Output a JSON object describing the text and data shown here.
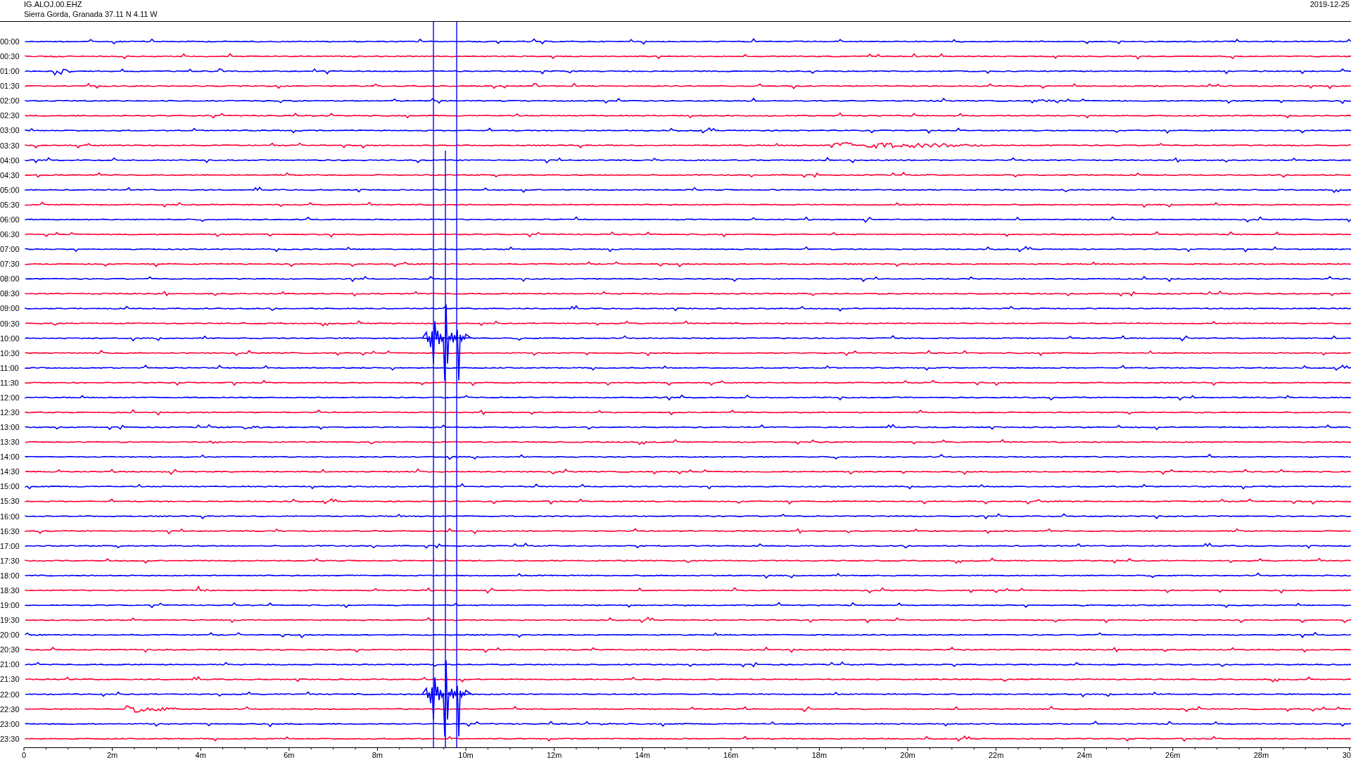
{
  "header": {
    "station": "IG.ALOJ.00.EHZ",
    "location": "Sierra Gorda, Granada  37.11 N 4.11 W",
    "date": "2019-12-25"
  },
  "rows": [
    {
      "label": "00:00",
      "color": "#0000ff"
    },
    {
      "label": "00:30",
      "color": "#ff0033"
    },
    {
      "label": "01:00",
      "color": "#0000ff"
    },
    {
      "label": "01:30",
      "color": "#ff0033"
    },
    {
      "label": "02:00",
      "color": "#0000ff"
    },
    {
      "label": "02:30",
      "color": "#ff0033"
    },
    {
      "label": "03:00",
      "color": "#0000ff"
    },
    {
      "label": "03:30",
      "color": "#ff0033"
    },
    {
      "label": "04:00",
      "color": "#0000ff"
    },
    {
      "label": "04:30",
      "color": "#ff0033"
    },
    {
      "label": "05:00",
      "color": "#0000ff"
    },
    {
      "label": "05:30",
      "color": "#ff0033"
    },
    {
      "label": "06:00",
      "color": "#0000ff"
    },
    {
      "label": "06:30",
      "color": "#ff0033"
    },
    {
      "label": "07:00",
      "color": "#0000ff"
    },
    {
      "label": "07:30",
      "color": "#ff0033"
    },
    {
      "label": "08:00",
      "color": "#0000ff"
    },
    {
      "label": "08:30",
      "color": "#ff0033"
    },
    {
      "label": "09:00",
      "color": "#0000ff"
    },
    {
      "label": "09:30",
      "color": "#ff0033"
    },
    {
      "label": "10:00",
      "color": "#0000ff"
    },
    {
      "label": "10:30",
      "color": "#ff0033"
    },
    {
      "label": "11:00",
      "color": "#0000ff"
    },
    {
      "label": "11:30",
      "color": "#ff0033"
    },
    {
      "label": "12:00",
      "color": "#0000ff"
    },
    {
      "label": "12:30",
      "color": "#ff0033"
    },
    {
      "label": "13:00",
      "color": "#0000ff"
    },
    {
      "label": "13:30",
      "color": "#ff0033"
    },
    {
      "label": "14:00",
      "color": "#0000ff"
    },
    {
      "label": "14:30",
      "color": "#ff0033"
    },
    {
      "label": "15:00",
      "color": "#0000ff"
    },
    {
      "label": "15:30",
      "color": "#ff0033"
    },
    {
      "label": "16:00",
      "color": "#0000ff"
    },
    {
      "label": "16:30",
      "color": "#ff0033"
    },
    {
      "label": "17:00",
      "color": "#0000ff"
    },
    {
      "label": "17:30",
      "color": "#ff0033"
    },
    {
      "label": "18:00",
      "color": "#0000ff"
    },
    {
      "label": "18:30",
      "color": "#ff0033"
    },
    {
      "label": "19:00",
      "color": "#0000ff"
    },
    {
      "label": "19:30",
      "color": "#ff0033"
    },
    {
      "label": "20:00",
      "color": "#0000ff"
    },
    {
      "label": "20:30",
      "color": "#ff0033"
    },
    {
      "label": "21:00",
      "color": "#0000ff"
    },
    {
      "label": "21:30",
      "color": "#ff0033"
    },
    {
      "label": "22:00",
      "color": "#0000ff"
    },
    {
      "label": "22:30",
      "color": "#ff0033"
    },
    {
      "label": "23:00",
      "color": "#0000ff"
    },
    {
      "label": "23:30",
      "color": "#ff0033"
    }
  ],
  "time_axis": {
    "labels": [
      "0",
      "2m",
      "4m",
      "6m",
      "8m",
      "10m",
      "12m",
      "14m",
      "16m",
      "18m",
      "20m",
      "22m",
      "24m",
      "26m",
      "28m",
      "30"
    ]
  }
}
